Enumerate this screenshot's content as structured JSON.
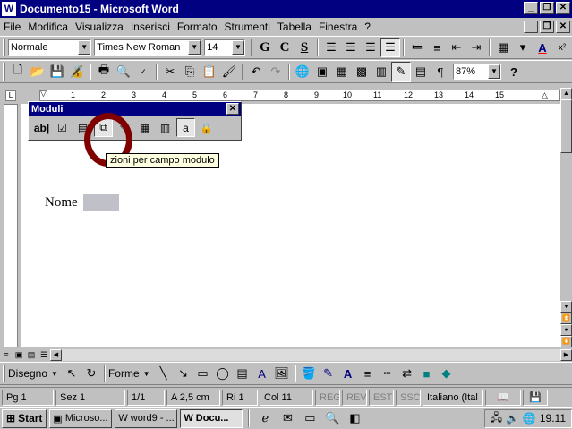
{
  "window": {
    "title": "Documento15 - Microsoft Word",
    "app_icon": "W"
  },
  "menu": [
    "File",
    "Modifica",
    "Visualizza",
    "Inserisci",
    "Formato",
    "Strumenti",
    "Tabella",
    "Finestra",
    "?"
  ],
  "format_toolbar": {
    "style": "Normale",
    "font": "Times New Roman",
    "size": "14",
    "bold": "G",
    "italic": "C",
    "underline": "S",
    "font_color_icon": "A"
  },
  "standard_toolbar": {
    "zoom": "87%",
    "help": "?"
  },
  "ruler": {
    "marks": [
      "1",
      "2",
      "3",
      "4",
      "5",
      "6",
      "7",
      "8",
      "9",
      "10",
      "11",
      "12",
      "13",
      "14",
      "15"
    ]
  },
  "moduli_toolbar": {
    "title": "Moduli",
    "tools": [
      "ab|",
      "☑",
      "▤",
      "⧉",
      "✎",
      "▦",
      "▥",
      "a",
      "🔒"
    ],
    "tooltip": "zioni per campo modulo"
  },
  "document": {
    "field_label": "Nome"
  },
  "drawing_toolbar": {
    "disegno": "Disegno",
    "forme": "Forme"
  },
  "statusbar": {
    "page": "Pg 1",
    "section": "Sez 1",
    "pages": "1/1",
    "position": "A  2,5 cm",
    "row": "Ri  1",
    "col": "Col  11",
    "reg": "REG",
    "rev": "REV",
    "est": "EST",
    "ssc": "SSC",
    "language": "Italiano (Ital"
  },
  "taskbar": {
    "start": "Start",
    "tasks": [
      "Microso...",
      "word9 - ...",
      "Docu..."
    ],
    "clock": "19.11"
  }
}
